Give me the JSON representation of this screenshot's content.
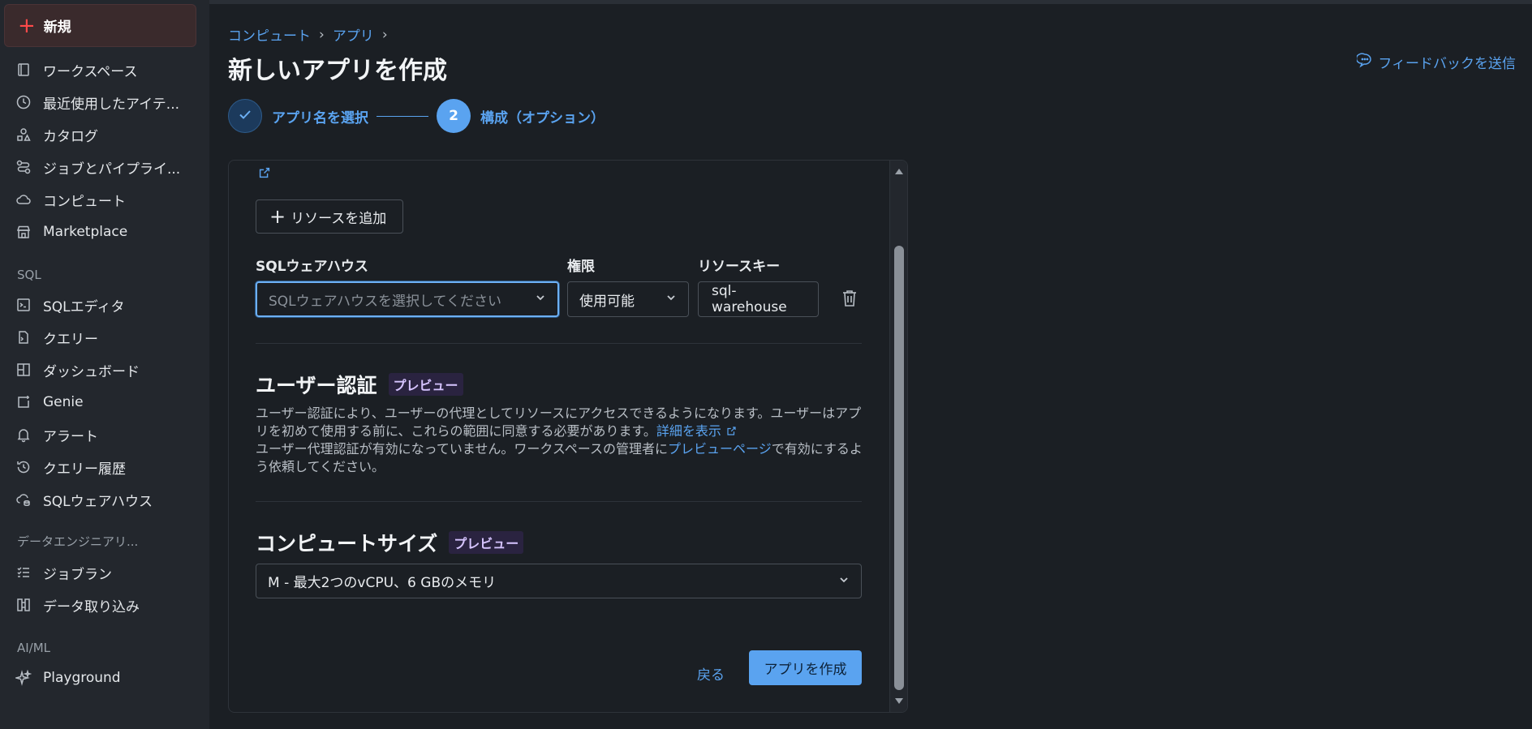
{
  "sidebar": {
    "new_label": "新規",
    "items": [
      {
        "label": "ワークスペース",
        "icon": "workspace-icon"
      },
      {
        "label": "最近使用したアイテ...",
        "icon": "clock-icon"
      },
      {
        "label": "カタログ",
        "icon": "catalog-icon"
      },
      {
        "label": "ジョブとパイプライ...",
        "icon": "jobs-icon"
      },
      {
        "label": "コンピュート",
        "icon": "cloud-icon"
      },
      {
        "label": "Marketplace",
        "icon": "store-icon"
      }
    ],
    "sql_section": "SQL",
    "sql_items": [
      {
        "label": "SQLエディタ",
        "icon": "editor-icon"
      },
      {
        "label": "クエリー",
        "icon": "query-icon"
      },
      {
        "label": "ダッシュボード",
        "icon": "dashboard-icon"
      },
      {
        "label": "Genie",
        "icon": "genie-icon"
      },
      {
        "label": "アラート",
        "icon": "bell-icon"
      },
      {
        "label": "クエリー履歴",
        "icon": "history-icon"
      },
      {
        "label": "SQLウェアハウス",
        "icon": "warehouse-icon"
      }
    ],
    "de_section": "データエンジニアリ...",
    "de_items": [
      {
        "label": "ジョブラン",
        "icon": "job-runs-icon"
      },
      {
        "label": "データ取り込み",
        "icon": "ingest-icon"
      }
    ],
    "ai_section": "AI/ML",
    "ai_items": [
      {
        "label": "Playground",
        "icon": "sparkle-icon"
      }
    ]
  },
  "breadcrumb": [
    "コンピュート",
    "アプリ"
  ],
  "breadcrumb_sep": "›",
  "page_title": "新しいアプリを作成",
  "feedback_label": "フィードバックを送信",
  "stepper": {
    "step1_label": "アプリ名を選択",
    "step2_number": "2",
    "step2_label": "構成（オプション）"
  },
  "resources": {
    "add_button": "リソースを追加",
    "warehouse_label": "SQLウェアハウス",
    "warehouse_placeholder": "SQLウェアハウスを選択してください",
    "permission_label": "権限",
    "permission_value": "使用可能",
    "key_label": "リソースキー",
    "key_value": "sql-warehouse"
  },
  "user_auth": {
    "title": "ユーザー認証",
    "badge": "プレビュー",
    "desc1": "ユーザー認証により、ユーザーの代理としてリソースにアクセスできるようになります。ユーザーはアプリを初めて使用する前に、これらの範囲に同意する必要があります。",
    "desc1_link": "詳細を表示",
    "desc2_pre": "ユーザー代理認証が有効になっていません。ワークスペースの管理者に",
    "desc2_link": "プレビューページ",
    "desc2_post": "で有効にするよう依頼してください。"
  },
  "compute_size": {
    "title": "コンピュートサイズ",
    "badge": "プレビュー",
    "value": "M - 最大2つのvCPU、6 GBのメモリ"
  },
  "footer": {
    "back": "戻る",
    "create": "アプリを作成"
  }
}
